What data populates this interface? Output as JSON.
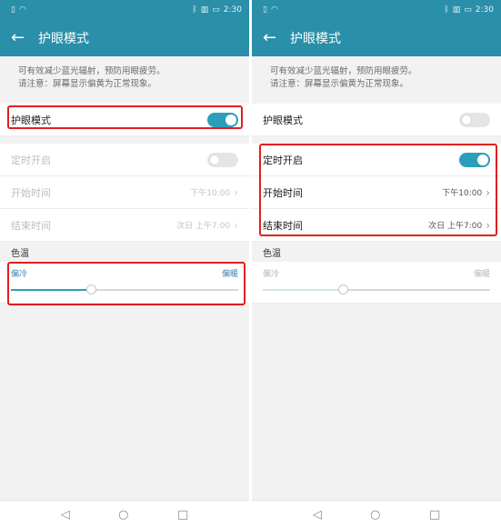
{
  "status": {
    "left_icons": [
      "sim-icon",
      "wifi-icon"
    ],
    "right_icons": [
      "bluetooth-icon",
      "vibrate-icon",
      "battery-icon"
    ],
    "time": "2:30"
  },
  "appbar": {
    "back_icon": "←",
    "title": "护眼模式"
  },
  "description": {
    "line1": "可有效减少蓝光辐射，预防用眼疲劳。",
    "line2": "请注意：屏幕显示偏黄为正常现象。"
  },
  "eye_mode": {
    "label": "护眼模式"
  },
  "schedule": {
    "label": "定时开启"
  },
  "start_time": {
    "label": "开始时间",
    "value": "下午10:00"
  },
  "end_time": {
    "label": "结束时间",
    "value": "次日 上午7:00"
  },
  "color_temp": {
    "section": "色温",
    "cool": "偏冷",
    "warm": "偏暖"
  },
  "chevron": "›",
  "navbar": {
    "back": "◁",
    "home": "○",
    "recent": "□"
  },
  "screens": [
    {
      "eye_mode_on": true,
      "schedule_on": false,
      "schedule_enabled": false,
      "slider_value": 0.35,
      "slider_enabled": true
    },
    {
      "eye_mode_on": false,
      "schedule_on": true,
      "schedule_enabled": true,
      "slider_value": 0.35,
      "slider_enabled": false
    }
  ],
  "colors": {
    "accent": "#2a9fb9",
    "header": "#2a8fa8",
    "highlight": "#e02020"
  }
}
